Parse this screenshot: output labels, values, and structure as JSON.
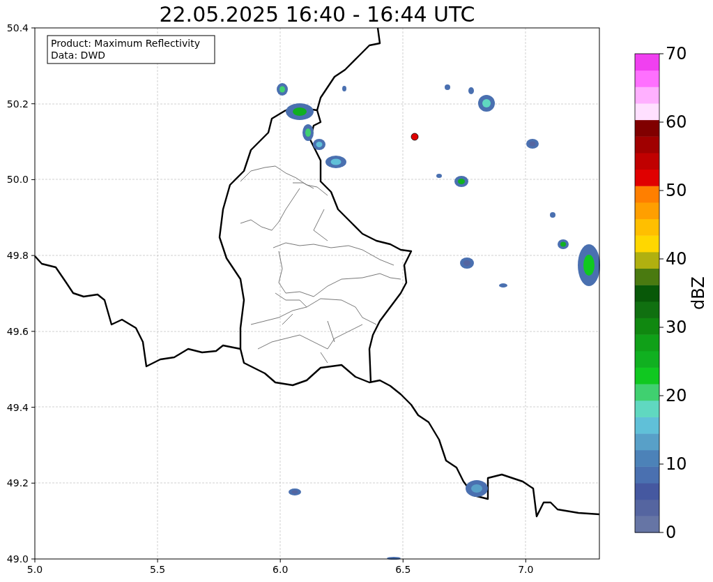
{
  "title": "22.05.2025 16:40 - 16:44 UTC",
  "info_box": {
    "lines": [
      "Product: Maximum Reflectivity",
      "Data: DWD"
    ]
  },
  "x_axis": {
    "ticks": [
      "5.0",
      "5.5",
      "6.0",
      "6.5",
      "7.0"
    ]
  },
  "y_axis": {
    "ticks": [
      "50.4",
      "50.2",
      "50.0",
      "49.8",
      "49.6",
      "49.4",
      "49.2",
      "49.0"
    ]
  },
  "colorbar": {
    "label": "dBZ",
    "ticks": [
      "70",
      "60",
      "50",
      "40",
      "30",
      "20",
      "10",
      "0"
    ],
    "segments": [
      {
        "color": "#6675a5"
      },
      {
        "color": "#5565a0"
      },
      {
        "color": "#4558a0"
      },
      {
        "color": "#4a70b0"
      },
      {
        "color": "#4c82b8"
      },
      {
        "color": "#58a0c8"
      },
      {
        "color": "#60c0d8"
      },
      {
        "color": "#60d8c0"
      },
      {
        "color": "#40d070"
      },
      {
        "color": "#10c820"
      },
      {
        "color": "#10b020"
      },
      {
        "color": "#10a018"
      },
      {
        "color": "#108810"
      },
      {
        "color": "#107010"
      },
      {
        "color": "#085808"
      },
      {
        "color": "#4a7a10"
      },
      {
        "color": "#b0b010"
      },
      {
        "color": "#ffd700"
      },
      {
        "color": "#ffbf00"
      },
      {
        "color": "#ff9f00"
      },
      {
        "color": "#ff7f00"
      },
      {
        "color": "#e00000"
      },
      {
        "color": "#c00000"
      },
      {
        "color": "#a00000"
      },
      {
        "color": "#800000"
      },
      {
        "color": "#ffe0ff"
      },
      {
        "color": "#ffb0ff"
      },
      {
        "color": "#ff70ff"
      },
      {
        "color": "#f040f0"
      }
    ]
  }
}
